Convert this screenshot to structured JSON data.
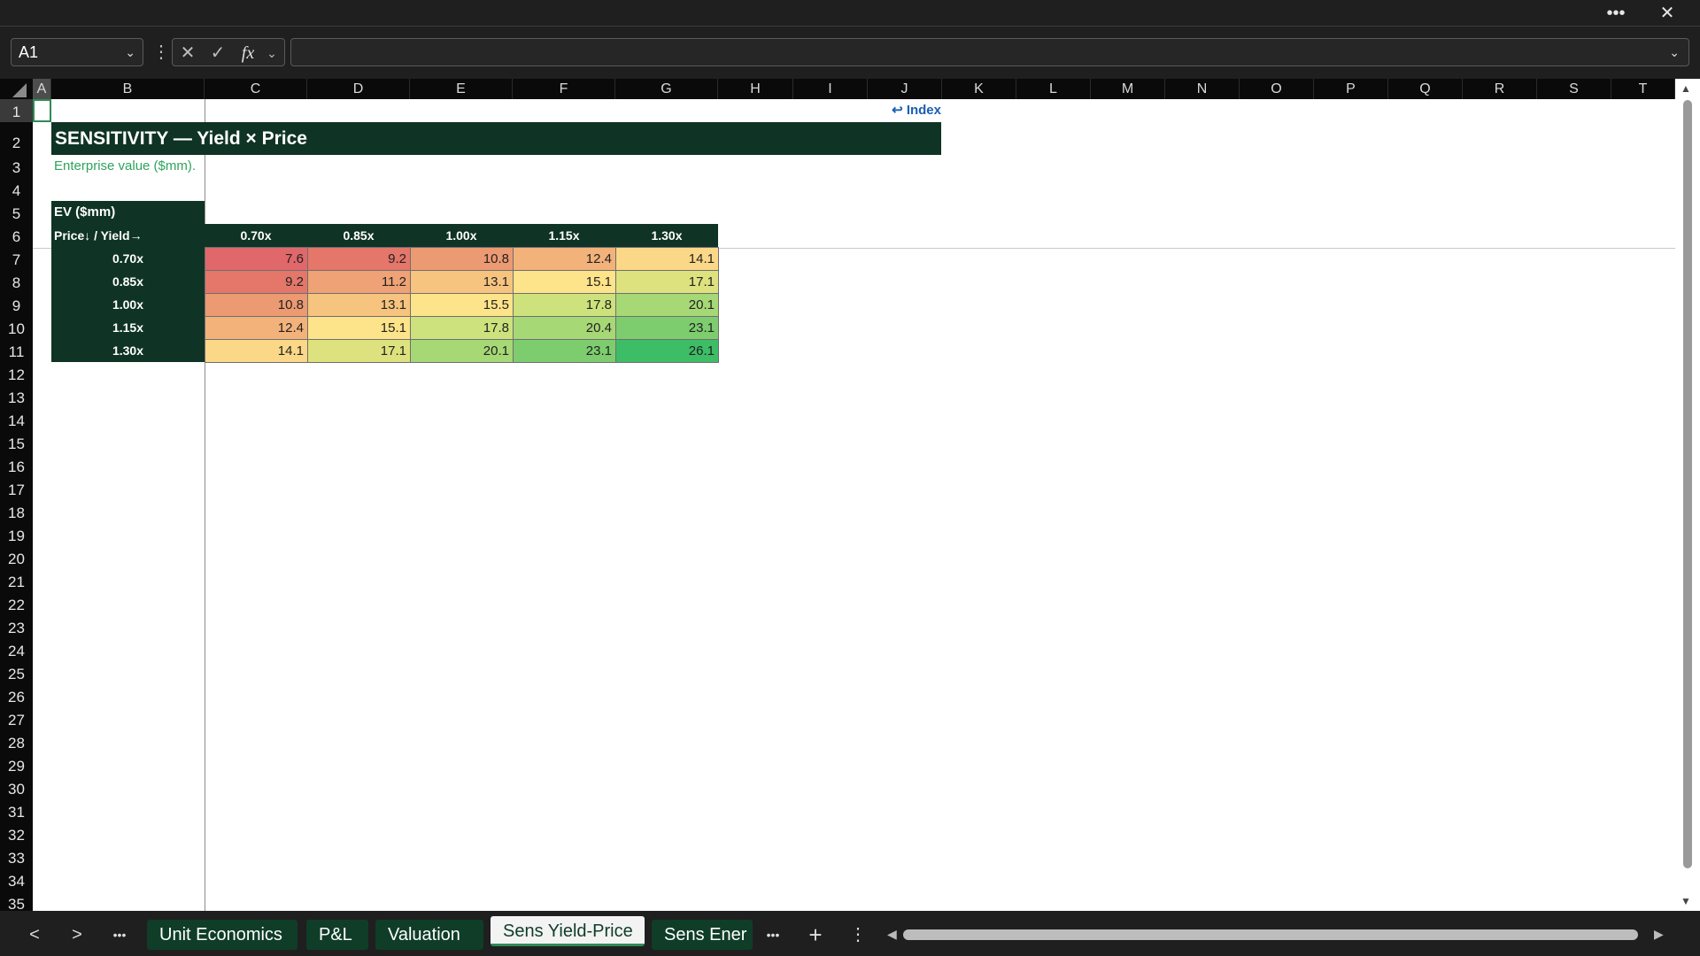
{
  "window": {
    "more_label": "•••",
    "close_label": "✕"
  },
  "formula_bar": {
    "name_box": "A1",
    "cancel": "✕",
    "enter": "✓",
    "fx": "fx",
    "formula": ""
  },
  "columns": [
    "A",
    "B",
    "C",
    "D",
    "E",
    "F",
    "G",
    "H",
    "I",
    "J",
    "K",
    "L",
    "M",
    "N",
    "O",
    "P",
    "Q",
    "R",
    "S",
    "T"
  ],
  "rows": [
    "1",
    "2",
    "3",
    "4",
    "5",
    "6",
    "7",
    "8",
    "9",
    "10",
    "11",
    "12",
    "13",
    "14",
    "15",
    "16",
    "17",
    "18",
    "19",
    "20",
    "21",
    "22",
    "23",
    "24",
    "25",
    "26",
    "27",
    "28",
    "29",
    "30",
    "31",
    "32",
    "33",
    "34",
    "35"
  ],
  "sheet": {
    "index_link": "↩ Index",
    "title": "SENSITIVITY — Yield × Price",
    "subtitle": "Enterprise value ($mm).",
    "table_label": "EV ($mm)",
    "corner": "Price↓ / Yield→",
    "col_headers": [
      "0.70x",
      "0.85x",
      "1.00x",
      "1.15x",
      "1.30x"
    ],
    "row_headers": [
      "0.70x",
      "0.85x",
      "1.00x",
      "1.15x",
      "1.30x"
    ],
    "values": [
      [
        "7.6",
        "9.2",
        "10.8",
        "12.4",
        "14.1"
      ],
      [
        "9.2",
        "11.2",
        "13.1",
        "15.1",
        "17.1"
      ],
      [
        "10.8",
        "13.1",
        "15.5",
        "17.8",
        "20.1"
      ],
      [
        "12.4",
        "15.1",
        "17.8",
        "20.4",
        "23.1"
      ],
      [
        "14.1",
        "17.1",
        "20.1",
        "23.1",
        "26.1"
      ]
    ],
    "colors": [
      [
        "#e0676a",
        "#e4766a",
        "#ec9a72",
        "#f2b27a",
        "#fbd788"
      ],
      [
        "#e4766a",
        "#efa275",
        "#f6c47f",
        "#fde389",
        "#dde27f"
      ],
      [
        "#ec9a72",
        "#f6c47f",
        "#fde389",
        "#cde27c",
        "#a6d876"
      ],
      [
        "#f2b27a",
        "#fde389",
        "#cde27c",
        "#a6d876",
        "#7dcd6f"
      ],
      [
        "#fbd788",
        "#dde27f",
        "#a6d876",
        "#7dcd6f",
        "#3dbd66"
      ]
    ]
  },
  "tabs": [
    "Unit Economics",
    "P&L",
    "Valuation",
    "Sens Yield-Price",
    "Sens Ener"
  ],
  "active_tab": "Sens Yield-Price",
  "nav": {
    "prev": "<",
    "next": ">",
    "more": "•••",
    "more2": "•••",
    "add": "+",
    "menu": "⋮"
  }
}
